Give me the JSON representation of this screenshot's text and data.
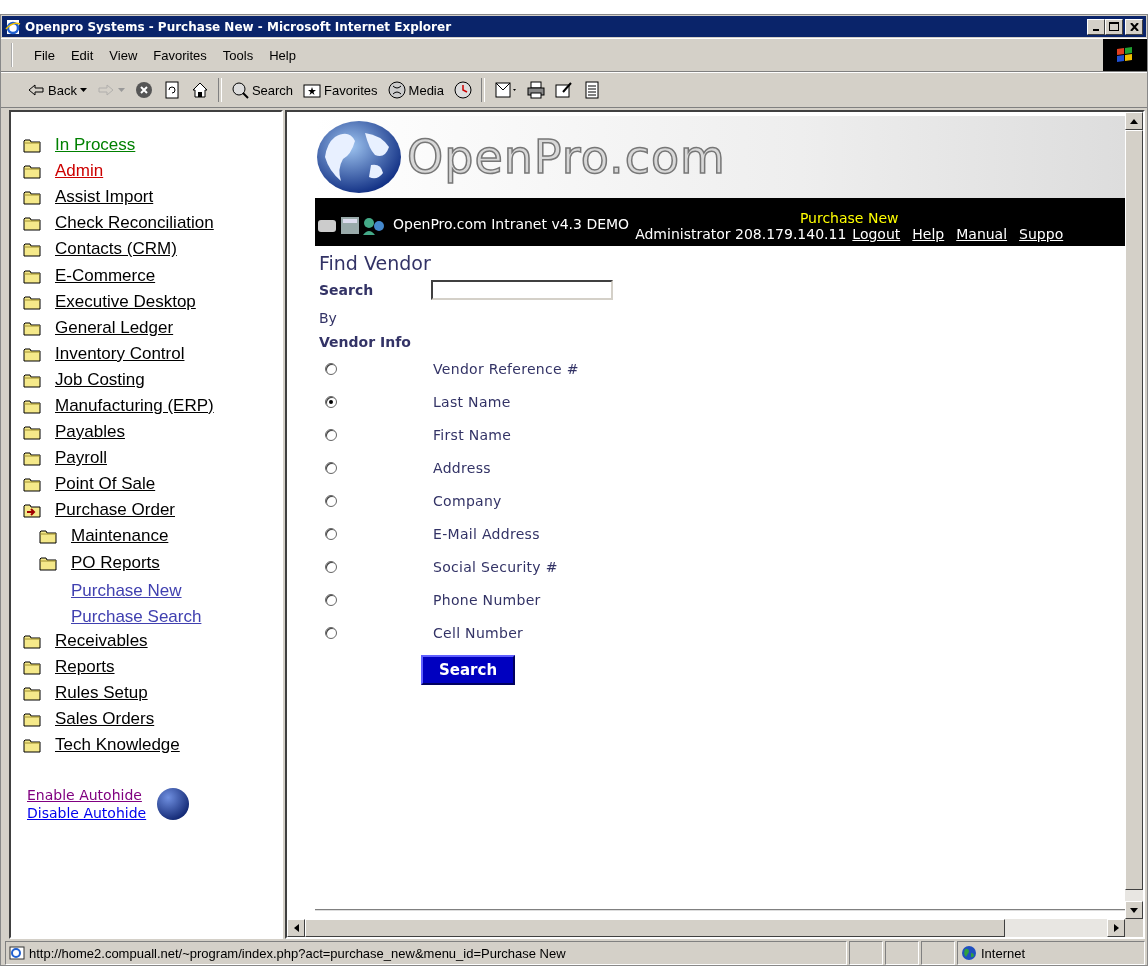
{
  "window": {
    "title": "Openpro Systems - Purchase New - Microsoft Internet Explorer"
  },
  "menu": [
    "File",
    "Edit",
    "View",
    "Favorites",
    "Tools",
    "Help"
  ],
  "toolbar": [
    {
      "kind": "back",
      "label": "Back",
      "disabled": false
    },
    {
      "kind": "forward",
      "disabled": true
    },
    {
      "kind": "stop",
      "disabled": false
    },
    {
      "kind": "refresh",
      "disabled": false
    },
    {
      "kind": "home",
      "disabled": false
    },
    {
      "kind": "sep"
    },
    {
      "kind": "search",
      "label": "Search",
      "disabled": false
    },
    {
      "kind": "favorites",
      "label": "Favorites",
      "disabled": false
    },
    {
      "kind": "media",
      "label": "Media",
      "disabled": false
    },
    {
      "kind": "history",
      "disabled": false
    },
    {
      "kind": "sep"
    },
    {
      "kind": "mail",
      "disabled": false
    },
    {
      "kind": "print",
      "disabled": false
    },
    {
      "kind": "edit",
      "disabled": false
    },
    {
      "kind": "discuss",
      "disabled": false
    }
  ],
  "sidebar": {
    "items": [
      {
        "kind": "folder",
        "label": "In Process",
        "color": "#008000"
      },
      {
        "kind": "folder",
        "label": "Admin",
        "color": "#cc0000"
      },
      {
        "kind": "folder",
        "label": "Assist Import",
        "color": "#000000"
      },
      {
        "kind": "folder",
        "label": "Check Reconciliation",
        "color": "#000000"
      },
      {
        "kind": "folder",
        "label": "Contacts (CRM)",
        "color": "#000000"
      },
      {
        "kind": "folder",
        "label": "E-Commerce",
        "color": "#000000"
      },
      {
        "kind": "folder",
        "label": "Executive Desktop",
        "color": "#000000"
      },
      {
        "kind": "folder",
        "label": "General Ledger",
        "color": "#000000"
      },
      {
        "kind": "folder",
        "label": "Inventory Control",
        "color": "#000000"
      },
      {
        "kind": "folder",
        "label": "Job Costing",
        "color": "#000000"
      },
      {
        "kind": "folder",
        "label": "Manufacturing (ERP)",
        "color": "#000000"
      },
      {
        "kind": "folder",
        "label": "Payables",
        "color": "#000000"
      },
      {
        "kind": "folder",
        "label": "Payroll",
        "color": "#000000"
      },
      {
        "kind": "folder",
        "label": "Point Of Sale",
        "color": "#000000"
      },
      {
        "kind": "open-folder",
        "label": "Purchase Order",
        "color": "#000000",
        "children": [
          {
            "kind": "folder",
            "label": "Maintenance",
            "color": "#000000"
          },
          {
            "kind": "folder",
            "label": "PO Reports",
            "color": "#000000"
          },
          {
            "kind": "page",
            "label": "Purchase New",
            "color": "#4040b0"
          },
          {
            "kind": "page",
            "label": "Purchase Search",
            "color": "#4040b0"
          }
        ]
      },
      {
        "kind": "folder",
        "label": "Receivables",
        "color": "#000000"
      },
      {
        "kind": "folder",
        "label": "Reports",
        "color": "#000000"
      },
      {
        "kind": "folder",
        "label": "Rules Setup",
        "color": "#000000"
      },
      {
        "kind": "folder",
        "label": "Sales Orders",
        "color": "#000000"
      },
      {
        "kind": "folder",
        "label": "Tech Knowledge",
        "color": "#000000"
      }
    ],
    "autohide_links": [
      {
        "label": "Enable Autohide",
        "color": "#800080"
      },
      {
        "label": "Disable Autohide",
        "color": "#0000ee"
      }
    ]
  },
  "banner": {
    "logo": "OpenPro.com",
    "product": "OpenPro.com Intranet v4.3 DEMO",
    "page": "Purchase New",
    "user": "Administrator 208.179.140.11",
    "links": [
      "Logout",
      "Help",
      "Manual",
      "Suppo"
    ]
  },
  "form": {
    "title": "Find Vendor",
    "search_label": "Search",
    "by_label": "By",
    "group_label": "Vendor Info",
    "options": [
      {
        "label": "Vendor Reference #",
        "selected": false
      },
      {
        "label": "Last Name",
        "selected": true
      },
      {
        "label": "First Name",
        "selected": false
      },
      {
        "label": "Address",
        "selected": false
      },
      {
        "label": "Company",
        "selected": false
      },
      {
        "label": "E-Mail Address",
        "selected": false
      },
      {
        "label": "Social Security #",
        "selected": false
      },
      {
        "label": "Phone Number",
        "selected": false
      },
      {
        "label": "Cell Number",
        "selected": false
      }
    ],
    "button": "Search"
  },
  "status_bar": {
    "url": "http://home2.compuall.net/~program/index.php?act=purchase_new&menu_id=Purchase New",
    "zone": "Internet"
  }
}
